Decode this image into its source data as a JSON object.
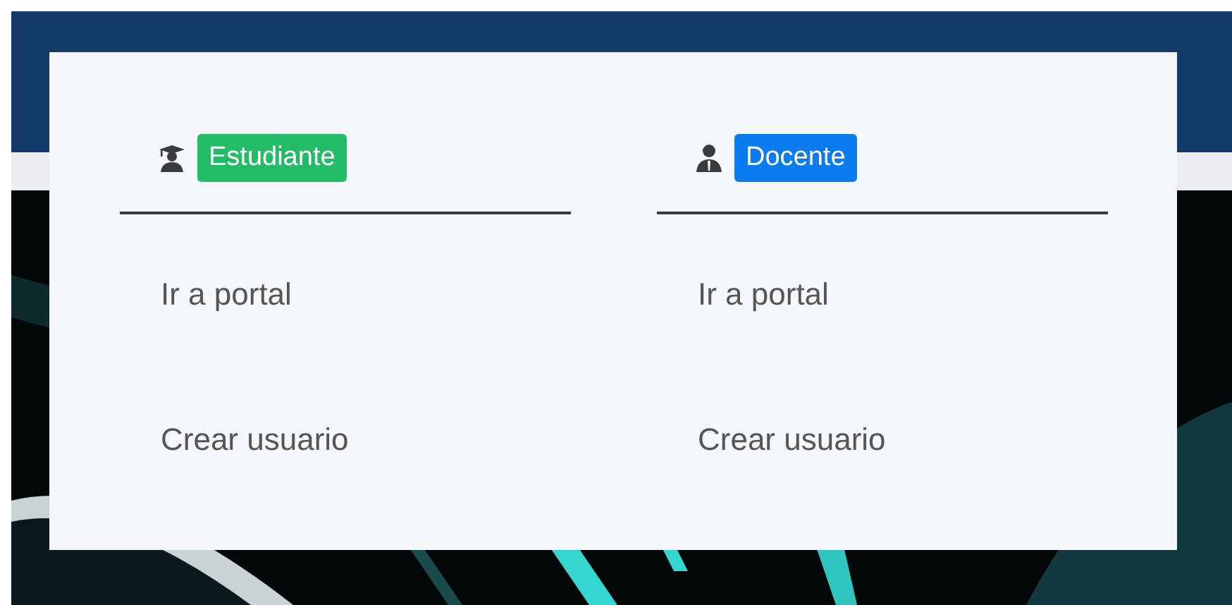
{
  "menu": {
    "columns": [
      {
        "kind": "student",
        "badge": {
          "label": "Estudiante",
          "color": "#22bb66"
        },
        "links": [
          "Ir a portal",
          "Crear usuario"
        ]
      },
      {
        "kind": "teacher",
        "badge": {
          "label": "Docente",
          "color": "#0b7cf0"
        },
        "links": [
          "Ir a portal",
          "Crear usuario"
        ]
      }
    ]
  }
}
